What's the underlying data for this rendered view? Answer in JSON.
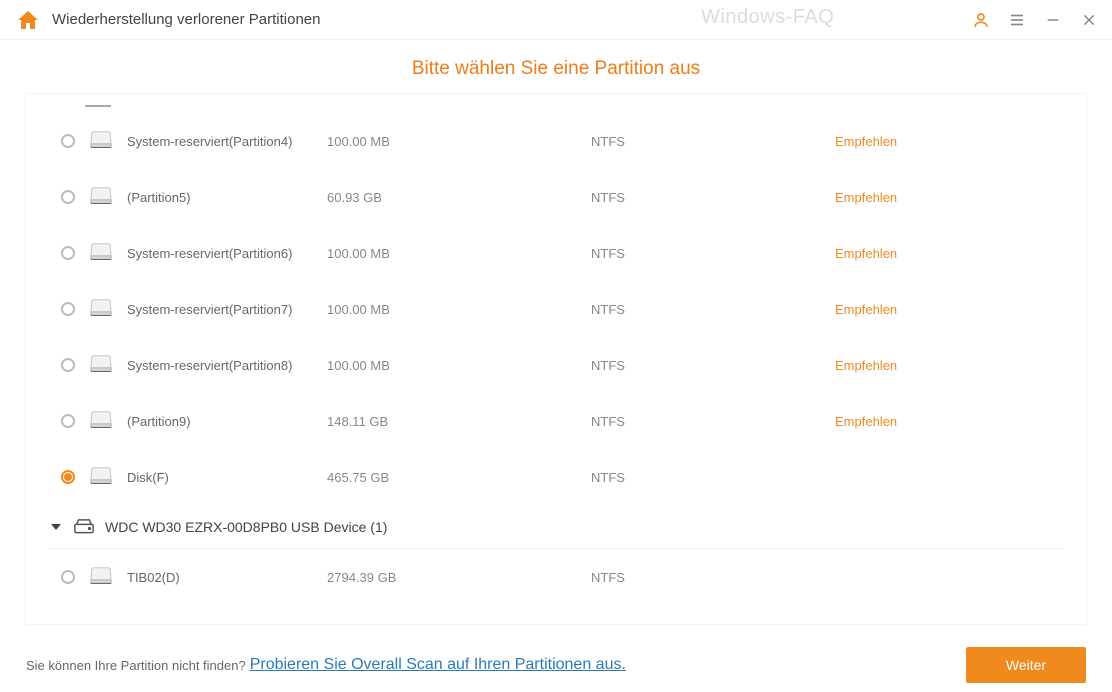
{
  "titlebar": {
    "title": "Wiederherstellung verlorener Partitionen",
    "watermark": "Windows-FAQ"
  },
  "heading": "Bitte wählen Sie eine Partition aus",
  "partitions": [
    {
      "name": "System-reserviert(Partition4)",
      "size": "100.00 MB",
      "fs": "NTFS",
      "recommend": "Empfehlen",
      "selected": false
    },
    {
      "name": "(Partition5)",
      "size": "60.93 GB",
      "fs": "NTFS",
      "recommend": "Empfehlen",
      "selected": false
    },
    {
      "name": "System-reserviert(Partition6)",
      "size": "100.00 MB",
      "fs": "NTFS",
      "recommend": "Empfehlen",
      "selected": false
    },
    {
      "name": "System-reserviert(Partition7)",
      "size": "100.00 MB",
      "fs": "NTFS",
      "recommend": "Empfehlen",
      "selected": false
    },
    {
      "name": "System-reserviert(Partition8)",
      "size": "100.00 MB",
      "fs": "NTFS",
      "recommend": "Empfehlen",
      "selected": false
    },
    {
      "name": "(Partition9)",
      "size": "148.11 GB",
      "fs": "NTFS",
      "recommend": "Empfehlen",
      "selected": false
    },
    {
      "name": "Disk(F)",
      "size": "465.75 GB",
      "fs": "NTFS",
      "recommend": "",
      "selected": true
    }
  ],
  "device": {
    "name": "WDC WD30 EZRX-00D8PB0 USB Device (1)"
  },
  "device_partitions": [
    {
      "name": "TIB02(D)",
      "size": "2794.39 GB",
      "fs": "NTFS",
      "recommend": "",
      "selected": false
    }
  ],
  "footer": {
    "text": "Sie können Ihre Partition nicht finden?",
    "link": "Probieren Sie Overall Scan auf Ihren Partitionen aus",
    "next": "Weiter"
  }
}
